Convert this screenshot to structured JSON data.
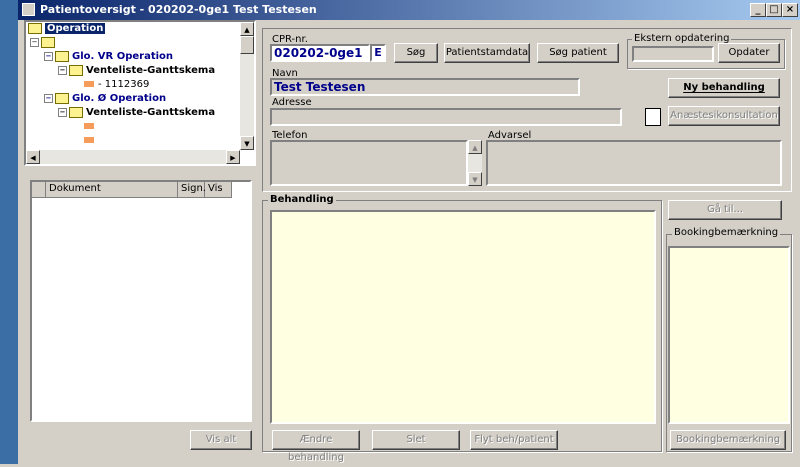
{
  "window": {
    "title": "Patientoversigt - 020202-0ge1 Test Testesen",
    "minimize": "_",
    "maximize": "□",
    "close": "×"
  },
  "tree": {
    "items": [
      {
        "label": "Operation"
      },
      {
        "label": ""
      },
      {
        "label": "Glo. VR Operation"
      },
      {
        "label": "Venteliste-Ganttskema"
      },
      {
        "label": "- 1112369"
      },
      {
        "label": "Glo. Ø Operation"
      },
      {
        "label": "Venteliste-Ganttskema"
      }
    ]
  },
  "documents": {
    "columns": [
      "Dokument",
      "Sign.",
      "Vis"
    ],
    "vis_alt_label": "Vis alt"
  },
  "patient": {
    "cpr_label": "CPR-nr.",
    "cpr_value": "020202-0ge1",
    "cpr_flag": "E",
    "search_button": "Søg",
    "patient_data_button": "Patientstamdata",
    "search_patient_button": "Søg patient",
    "external_update_group": "Ekstern opdatering",
    "update_button": "Opdater",
    "name_label": "Navn",
    "name_value": "Test Testesen",
    "new_treatment_button": "Ny behandling",
    "address_label": "Adresse",
    "anesthesia_button": "Anæstesikonsultation",
    "phone_label": "Telefon",
    "warning_label": "Advarsel"
  },
  "treatment": {
    "title": "Behandling",
    "change_button": "Ændre behandling",
    "delete_button": "Slet",
    "move_button": "Flyt beh/patient",
    "goto_button": "Gå til...",
    "booking_group": "Bookingbemærkning",
    "booking_button": "Bookingbemærkning"
  },
  "colors": {
    "accent_title": "#0a246a",
    "tree_text": "#00008b",
    "note_bg": "#ffffe1"
  }
}
